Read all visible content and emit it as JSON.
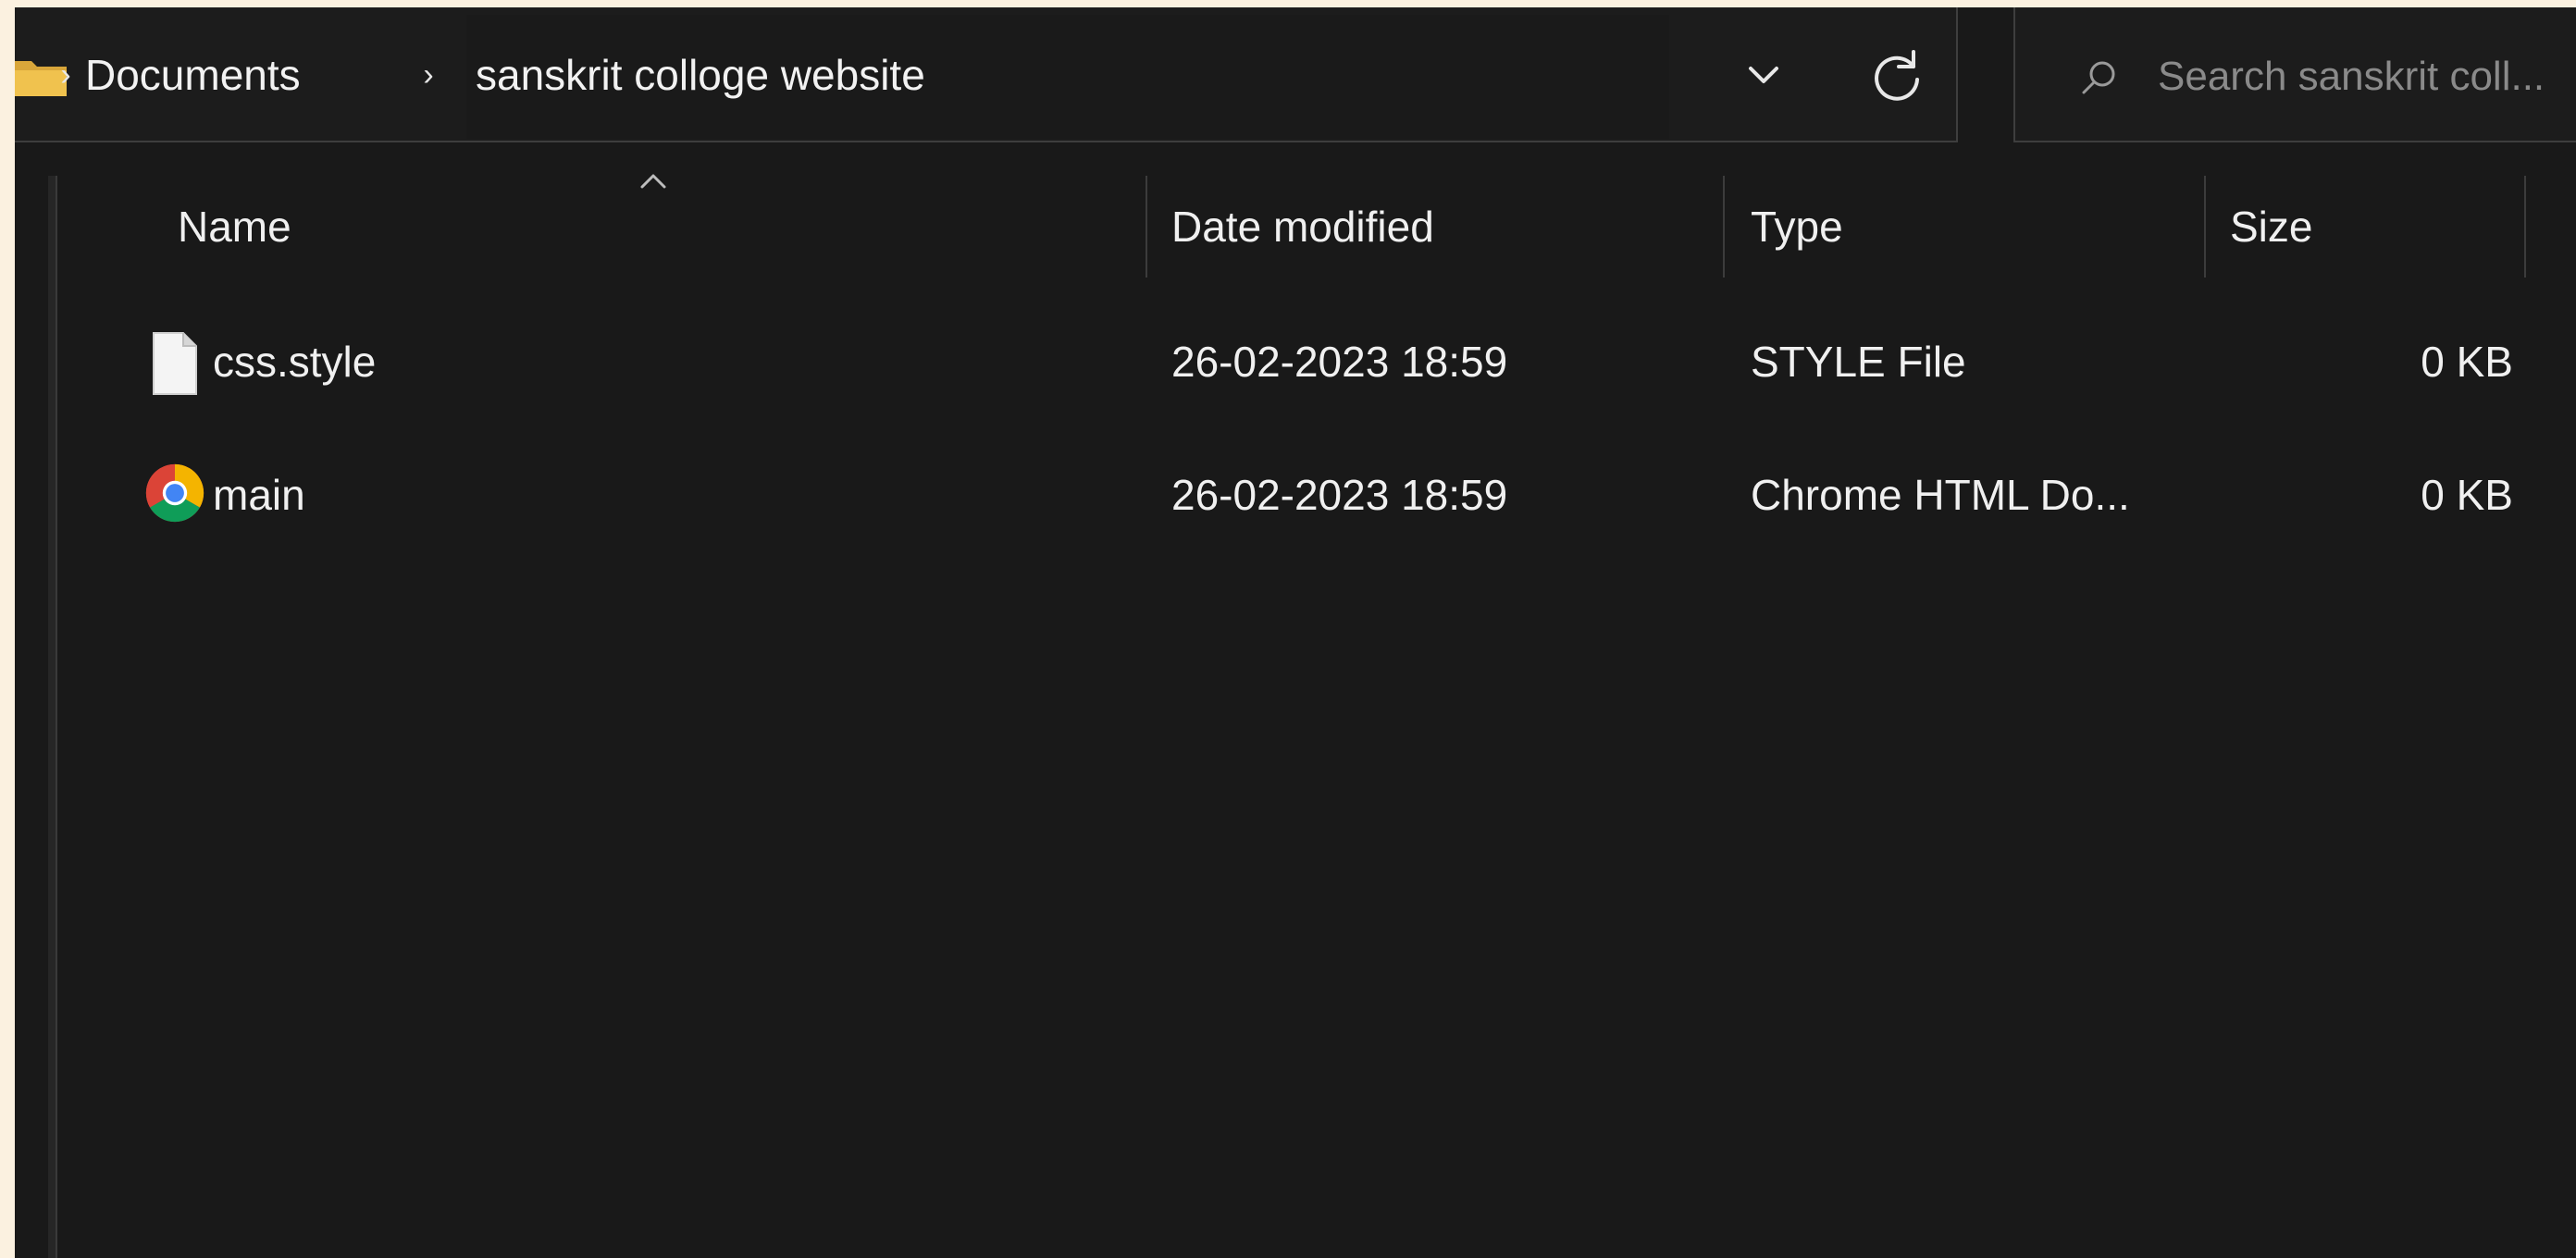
{
  "address_bar": {
    "breadcrumbs": [
      "Documents",
      "sanskrit colloge website"
    ],
    "chevron": "›",
    "icons": {
      "folder": "folder-icon",
      "history": "chevron-down-icon",
      "refresh": "refresh-icon"
    }
  },
  "search": {
    "placeholder": "Search sanskrit coll...",
    "icon": "search-icon"
  },
  "columns": {
    "name": "Name",
    "date": "Date modified",
    "type": "Type",
    "size": "Size",
    "sort_icon": "sort-ascending-icon"
  },
  "files": [
    {
      "name": "css.style",
      "date": "26-02-2023 18:59",
      "type": "STYLE File",
      "size": "0 KB",
      "icon": "blank-file-icon"
    },
    {
      "name": "main",
      "date": "26-02-2023 18:59",
      "type": "Chrome HTML Do...",
      "size": "0 KB",
      "icon": "chrome-icon"
    }
  ],
  "colors": {
    "background": "#191919",
    "text": "#f0f0f0",
    "border": "#3e3e3e",
    "folder_yellow": "#e8b33c",
    "frame_cream": "#fbf1e0"
  }
}
